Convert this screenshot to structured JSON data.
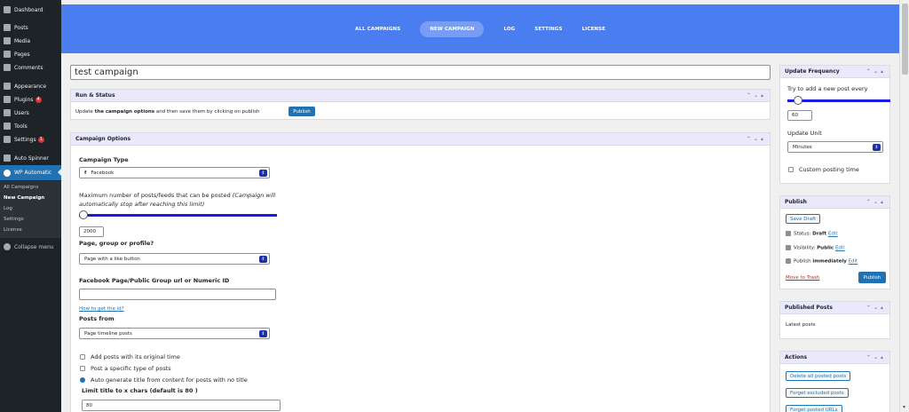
{
  "sidebar": {
    "items": [
      {
        "label": "Dashboard"
      },
      {
        "label": "Posts"
      },
      {
        "label": "Media"
      },
      {
        "label": "Pages"
      },
      {
        "label": "Comments"
      },
      {
        "label": "Appearance"
      },
      {
        "label": "Plugins",
        "badge": "4"
      },
      {
        "label": "Users"
      },
      {
        "label": "Tools"
      },
      {
        "label": "Settings",
        "badge": "1"
      },
      {
        "label": "Auto Spinner"
      },
      {
        "label": "WP Automatic"
      }
    ],
    "sub": [
      {
        "label": "All Campaigns"
      },
      {
        "label": "New Campaign"
      },
      {
        "label": "Log"
      },
      {
        "label": "Settings"
      },
      {
        "label": "License"
      }
    ],
    "collapse": "Collapse menu"
  },
  "header": {
    "tabs": [
      {
        "label": "ALL CAMPAIGNS"
      },
      {
        "label": "NEW CAMPAIGN"
      },
      {
        "label": "LOG"
      },
      {
        "label": "SETTINGS"
      },
      {
        "label": "LICENSE"
      }
    ]
  },
  "campaign_title": "test campaign",
  "run_status": {
    "title": "Run & Status",
    "text_pre": "Update ",
    "text_bold": "the campaign options",
    "text_post": " and then save them by clicking on publish",
    "button": "Publish"
  },
  "options": {
    "title": "Campaign Options",
    "campaign_type_label": "Campaign Type",
    "campaign_type_value": "Facebook",
    "max_posts_label": "Maximum number of posts/feeds that can be posted",
    "max_posts_note": "(Campaign will automatically stop after reaching this limit)",
    "max_posts_value": "2000",
    "page_group_label": "Page, group or profile?",
    "page_group_value": "Page with a like button",
    "fb_url_label": "Facebook Page/Public Group url or Numeric ID",
    "how_link": "How to get the id?",
    "posts_from_label": "Posts from",
    "posts_from_value": "Page timeline posts",
    "cb1": "Add posts with its original time",
    "cb2": "Post a specific type of posts",
    "radio1": "Auto generate title from content for posts with no title",
    "limit_label": "Limit title to x chars (default is 80 )",
    "limit_value": "80"
  },
  "update_freq": {
    "title": "Update Frequency",
    "label": "Try to add a new post every",
    "value": "60",
    "unit_label": "Update Unit",
    "unit_value": "Minutes",
    "custom": "Custom posting time"
  },
  "publish": {
    "title": "Publish",
    "save_draft": "Save Draft",
    "status_label": "Status: ",
    "status_value": "Draft",
    "visibility_label": "Visibility: ",
    "visibility_value": "Public",
    "publish_label": "Publish ",
    "publish_value": "immediately",
    "edit": "Edit",
    "trash": "Move to Trash",
    "button": "Publish"
  },
  "published_posts": {
    "title": "Published Posts",
    "text": "Latest posts"
  },
  "actions": {
    "title": "Actions",
    "b1": "Delete all posted posts",
    "b2": "Forget excluded posts",
    "b3": "Forget posted URLs"
  },
  "colors": {
    "accent": "#4a7ef0",
    "wp_blue": "#2271b1",
    "sidebar": "#1d2327",
    "header_tint": "#e9e9fb"
  }
}
